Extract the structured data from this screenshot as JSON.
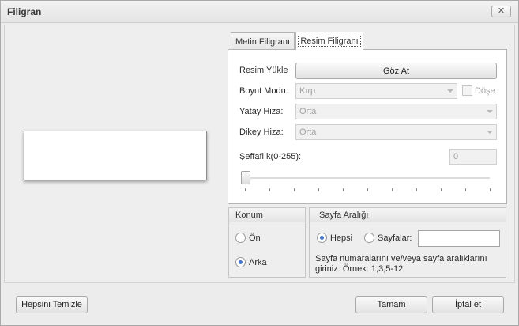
{
  "window": {
    "title": "Filigran",
    "close_label": "✕"
  },
  "tabs": [
    {
      "label": "Metin Filigranı",
      "active": false
    },
    {
      "label": "Resim Filigranı",
      "active": true
    }
  ],
  "image_tab": {
    "load_label": "Resim Yükle",
    "browse_button": "Göz At",
    "size_mode_label": "Boyut Modu:",
    "size_mode_value": "Kırp",
    "tile_label": "Döşe",
    "tile_checked": false,
    "h_align_label": "Yatay Hiza:",
    "h_align_value": "Orta",
    "v_align_label": "Dikey Hiza:",
    "v_align_value": "Orta",
    "transparency_label": "Şeffaflık(0-255):",
    "transparency_value": "0",
    "transparency_slider_value": 0,
    "transparency_max": 255
  },
  "position_group": {
    "title": "Konum",
    "options": [
      {
        "label": "Ön",
        "selected": false
      },
      {
        "label": "Arka",
        "selected": true
      }
    ]
  },
  "page_range_group": {
    "title": "Sayfa Aralığı",
    "all_label": "Hepsi",
    "all_selected": true,
    "pages_label": "Sayfalar:",
    "pages_value": "",
    "hint_line1": "Sayfa numaralarını ve/veya sayfa aralıklarını",
    "hint_line2": "giriniz. Örnek: 1,3,5-12"
  },
  "footer": {
    "clear_all_button": "Hepsini Temizle",
    "ok_button": "Tamam",
    "cancel_button": "İptal et"
  },
  "icons": {
    "close": "close-icon",
    "dropdown": "chevron-down-icon"
  }
}
